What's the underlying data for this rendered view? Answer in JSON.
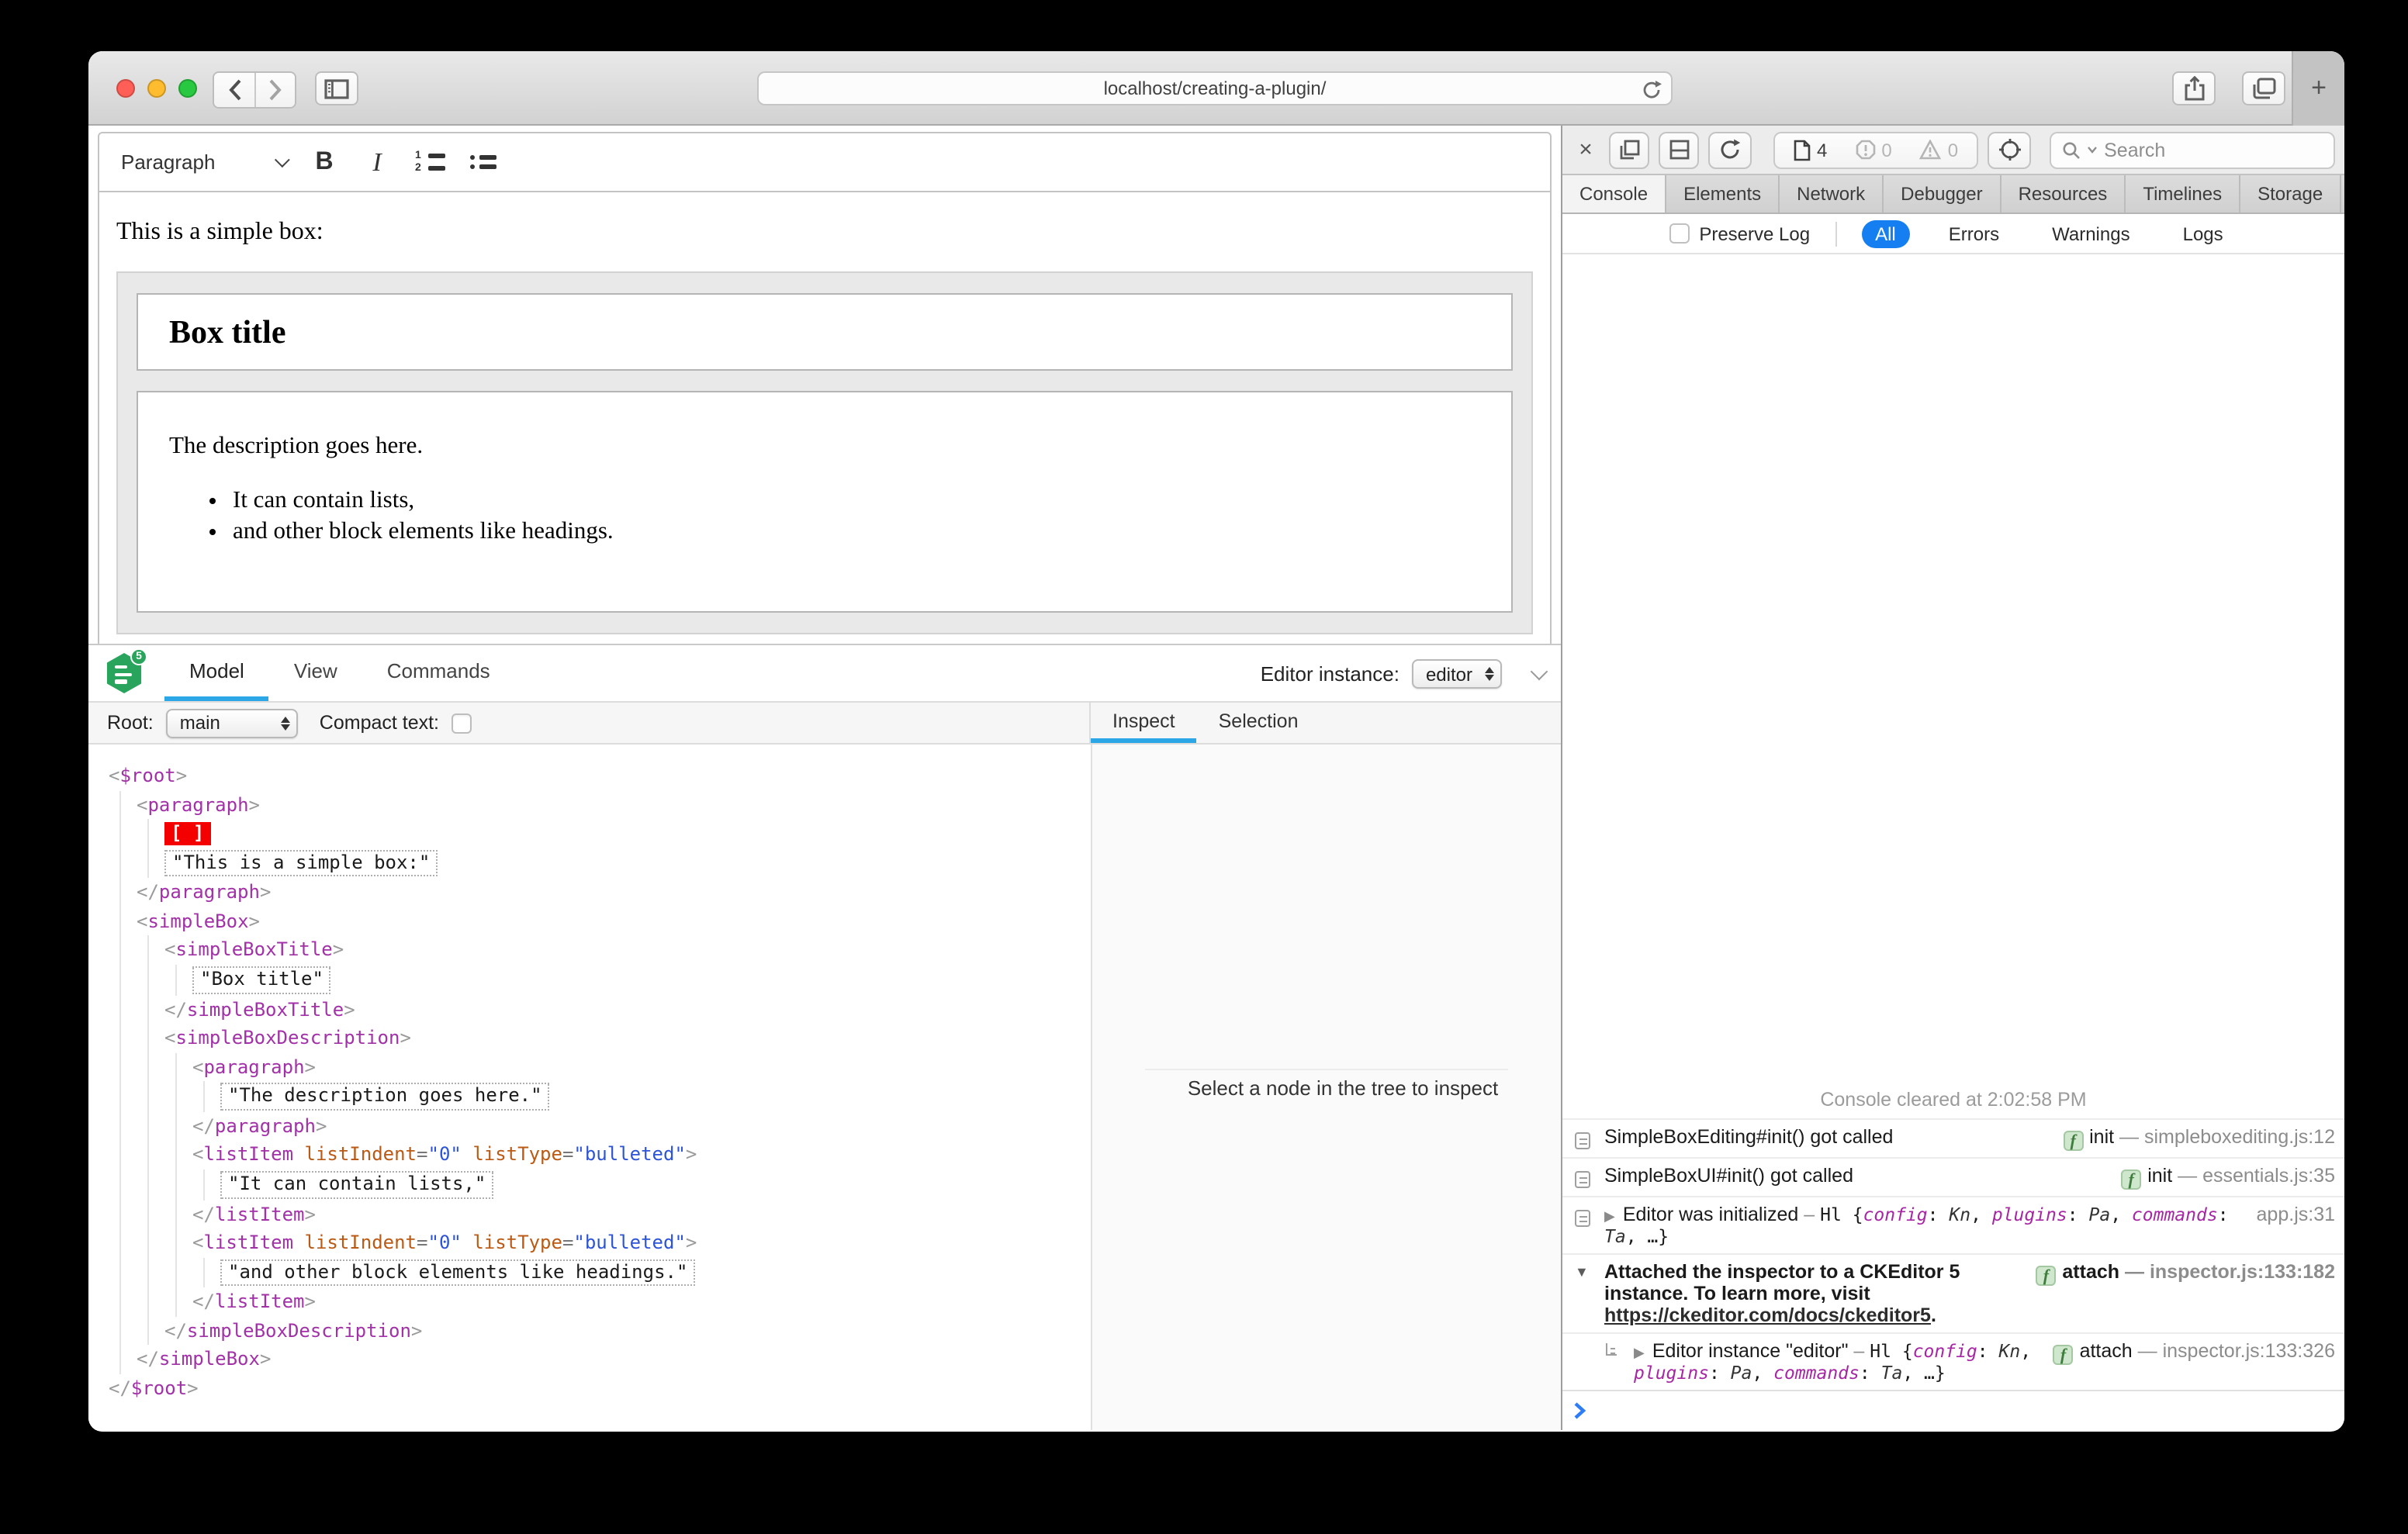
{
  "browser": {
    "url": "localhost/creating-a-plugin/",
    "new_tab_label": "+",
    "traffic_lights": {
      "close": "#ff5f57",
      "minimize": "#febc2e",
      "zoom": "#28c840"
    }
  },
  "editor": {
    "toolbar": {
      "paragraph_label": "Paragraph"
    },
    "content": {
      "intro": "This is a simple box:",
      "box_title": "Box title",
      "description": "The description goes here.",
      "list_items": [
        "It can contain lists,",
        "and other block elements like headings."
      ]
    }
  },
  "inspector": {
    "tabs": [
      {
        "label": "Model",
        "active": true
      },
      {
        "label": "View",
        "active": false
      },
      {
        "label": "Commands",
        "active": false
      }
    ],
    "editor_instance_label": "Editor instance:",
    "editor_instance_value": "editor",
    "root_label": "Root:",
    "root_value": "main",
    "compact_text_label": "Compact text:",
    "side_tabs": [
      {
        "label": "Inspect",
        "active": true
      },
      {
        "label": "Selection",
        "active": false
      }
    ],
    "empty_message": "Select a node in the tree to inspect",
    "tree": [
      {
        "kind": "open",
        "indent": 0,
        "tag": "$root"
      },
      {
        "kind": "open",
        "indent": 1,
        "tag": "paragraph"
      },
      {
        "kind": "selection",
        "indent": 2,
        "marker": "[ ]"
      },
      {
        "kind": "text",
        "indent": 2,
        "text": "\"This is a simple box:\""
      },
      {
        "kind": "close",
        "indent": 1,
        "tag": "paragraph"
      },
      {
        "kind": "open",
        "indent": 1,
        "tag": "simpleBox"
      },
      {
        "kind": "open",
        "indent": 2,
        "tag": "simpleBoxTitle"
      },
      {
        "kind": "text",
        "indent": 3,
        "text": "\"Box title\""
      },
      {
        "kind": "close",
        "indent": 2,
        "tag": "simpleBoxTitle"
      },
      {
        "kind": "open",
        "indent": 2,
        "tag": "simpleBoxDescription"
      },
      {
        "kind": "open",
        "indent": 3,
        "tag": "paragraph"
      },
      {
        "kind": "text",
        "indent": 4,
        "text": "\"The description goes here.\""
      },
      {
        "kind": "close",
        "indent": 3,
        "tag": "paragraph"
      },
      {
        "kind": "open",
        "indent": 3,
        "tag": "listItem",
        "attrs": [
          {
            "name": "listIndent",
            "value": "0"
          },
          {
            "name": "listType",
            "value": "bulleted"
          }
        ]
      },
      {
        "kind": "text",
        "indent": 4,
        "text": "\"It can contain lists,\""
      },
      {
        "kind": "close",
        "indent": 3,
        "tag": "listItem"
      },
      {
        "kind": "open",
        "indent": 3,
        "tag": "listItem",
        "attrs": [
          {
            "name": "listIndent",
            "value": "0"
          },
          {
            "name": "listType",
            "value": "bulleted"
          }
        ]
      },
      {
        "kind": "text",
        "indent": 4,
        "text": "\"and other block elements like headings.\""
      },
      {
        "kind": "close",
        "indent": 3,
        "tag": "listItem"
      },
      {
        "kind": "close",
        "indent": 2,
        "tag": "simpleBoxDescription"
      },
      {
        "kind": "close",
        "indent": 1,
        "tag": "simpleBox"
      },
      {
        "kind": "close",
        "indent": 0,
        "tag": "$root"
      }
    ]
  },
  "devtools": {
    "toolbar": {
      "page_count": "4",
      "error_count": "0",
      "warning_count": "0",
      "search_label": "Search"
    },
    "tabs": [
      "Console",
      "Elements",
      "Network",
      "Debugger",
      "Resources",
      "Timelines",
      "Storage"
    ],
    "active_tab": "Console",
    "overflow_tab": "»",
    "add_tab": "+",
    "filter": {
      "preserve_log_label": "Preserve Log",
      "options": [
        "All",
        "Errors",
        "Warnings",
        "Logs"
      ],
      "active": "All"
    },
    "cleared_message": "Console cleared at 2:02:58 PM",
    "messages": [
      {
        "icon": "log",
        "parts": [
          {
            "t": "SimpleBoxEditing#init() got called"
          }
        ],
        "meta": {
          "badge": "init",
          "location": "simpleboxediting.js:12"
        }
      },
      {
        "icon": "log",
        "parts": [
          {
            "t": "SimpleBoxUI#init() got called"
          }
        ],
        "meta": {
          "badge": "init",
          "location": "essentials.js:35"
        }
      },
      {
        "icon": "log",
        "disclosure": "collapsed",
        "parts": [
          {
            "t": "Editor was initialized"
          },
          {
            "t": " – ",
            "s": "dim"
          },
          {
            "t": "Hl {",
            "s": "code"
          },
          {
            "t": "config",
            "s": "key"
          },
          {
            "t": ": ",
            "s": "code"
          },
          {
            "t": "Kn",
            "s": "val"
          },
          {
            "t": ", ",
            "s": "code"
          },
          {
            "t": "plugins",
            "s": "key"
          },
          {
            "t": ": ",
            "s": "code"
          },
          {
            "t": "Pa",
            "s": "val"
          },
          {
            "t": ", ",
            "s": "code"
          },
          {
            "t": "commands",
            "s": "key"
          },
          {
            "t": ": ",
            "s": "code"
          },
          {
            "t": "Ta",
            "s": "val"
          },
          {
            "t": ", …}",
            "s": "code"
          }
        ],
        "meta": {
          "location": "app.js:31"
        }
      },
      {
        "disclosure": "expanded",
        "bold": true,
        "parts": [
          {
            "t": "Attached the inspector to a CKEditor 5 instance. To learn more, visit "
          },
          {
            "t": "https://ckeditor.com/docs/ckeditor5",
            "s": "link"
          },
          {
            "t": "."
          }
        ],
        "meta": {
          "badge": "attach",
          "location": "inspector.js:133:182"
        }
      },
      {
        "icon": "child",
        "indent": true,
        "disclosure": "collapsed",
        "parts": [
          {
            "t": "Editor instance \"editor\""
          },
          {
            "t": " – ",
            "s": "dim"
          },
          {
            "t": "Hl {",
            "s": "code"
          },
          {
            "t": "config",
            "s": "key"
          },
          {
            "t": ": ",
            "s": "code"
          },
          {
            "t": "Kn",
            "s": "val"
          },
          {
            "t": ", ",
            "s": "code"
          },
          {
            "t": "plugins",
            "s": "key"
          },
          {
            "t": ": ",
            "s": "code"
          },
          {
            "t": "Pa",
            "s": "val"
          },
          {
            "t": ", ",
            "s": "code"
          },
          {
            "t": "commands",
            "s": "key"
          },
          {
            "t": ": ",
            "s": "code"
          },
          {
            "t": "Ta",
            "s": "val"
          },
          {
            "t": ", …}",
            "s": "code"
          }
        ],
        "meta": {
          "badge": "attach",
          "location": "inspector.js:133:326"
        }
      }
    ]
  },
  "colors": {
    "filter_active_pill": "#157ff1",
    "inspector_active_tab": "#2ba7e8",
    "tree_tag": "#a231a8",
    "tree_attr_name": "#bb5a14",
    "tree_attr_value": "#2d54d8",
    "selection_marker": "#f40000",
    "function_badge_bg": "#cfe7cd",
    "prompt_chevron": "#2f7cf7"
  }
}
